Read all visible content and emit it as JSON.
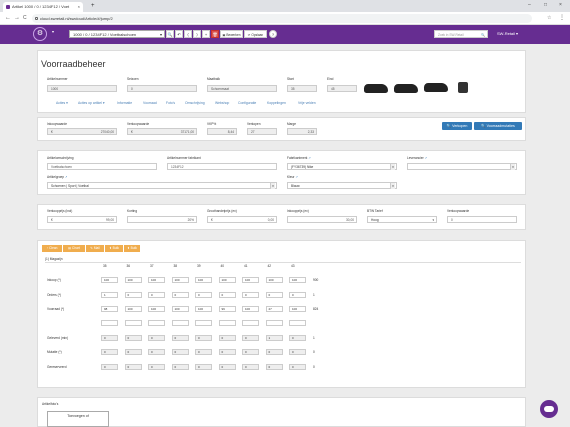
{
  "browser": {
    "tab_title": "Artikel 1000 / 0 / 1234F12 / Voet",
    "tab_close": "×",
    "new_tab": "+",
    "url": "cloud.swretail.nl/swcloud/Article/#/jump/2",
    "min": "–",
    "max": "□",
    "close": "×",
    "back": "←",
    "forward": "→",
    "reload": "C",
    "star": "☆",
    "menu": "⋮"
  },
  "app": {
    "logo_glyph": "⚙",
    "menu_caret": "▾",
    "article_select": "1000 / 0 / 1234F12 / Voetbalschoen",
    "dd": "▾",
    "tools": [
      "🔍",
      "↶",
      "⟨",
      "⟩",
      "+",
      "🗑"
    ],
    "btn_bewerken": "▣ Bewerken",
    "btn_opslaan": "⟳ Opslaan",
    "btn_info": "?",
    "search_placeholder": "Zoek in SW-Retail",
    "search_icon": "🔍",
    "account": "SW-Retail ▾",
    "accent": "#662d91"
  },
  "page": {
    "title": "Voorraadbeheer"
  },
  "head": {
    "l_artnr": "Artikelnummer",
    "v_artnr": "1000",
    "l_seizoen": "Seizoen",
    "v_seizoen": "0",
    "l_maatbalk": "Maatbalk",
    "v_maatbalk": "Schoenmaat",
    "l_start": "Start",
    "v_start": "35",
    "l_eind": "Eind",
    "v_eind": "45"
  },
  "nav": [
    "Acties ▾",
    "Acties op artikel ▾",
    "Informatie",
    "Voorraad",
    "Foto's",
    "Omschrijving",
    "Webshop",
    "Configuratie",
    "Koppelingen",
    "Vrije velden"
  ],
  "prices": {
    "l_inkwaarde": "Inkoopwaarde",
    "v_inkwaarde": "27040,00",
    "l_verkwaarde": "Verkoopwaarde",
    "v_verkwaarde": "37171,00",
    "l_vkpct": "VKP%",
    "v_vkpct": "8,44",
    "l_verkopen": "Verkopen",
    "v_verkopen": "27",
    "l_marge": "Marge",
    "v_marge": "2,33",
    "cur": "€",
    "btn_verkopen": "🔍 Verkopen",
    "btn_mutaties": "🔍 Voorraadmutaties"
  },
  "desc": {
    "l_oms": "Artikelomschrijving",
    "v_oms": "Voetbalschoen",
    "l_fabnr": "Artikelnummer fabrikant",
    "v_fabnr": "1234F12",
    "l_fabmerk": "Fabrikantmerk",
    "v_fabmerk": "(FY36739) Nike",
    "l_leverancier": "Leverancier",
    "v_leverancier": "",
    "l_groep": "Artikelgroep",
    "v_groep": "Schoenen | Sport | Voetbal",
    "l_kleur": "Kleur",
    "v_kleur": "Blauw",
    "link_icon": "↗",
    "dd": "▾"
  },
  "prices2": {
    "l_verkoop": "Verkoopprijs (incl)",
    "v_verkoop": "99,00",
    "l_korting": "Korting",
    "v_korting": "20%",
    "l_groot": "Groothandelprijs (ex)",
    "v_groot": "0,00",
    "l_inkoop": "Inkoopprijs (ex)",
    "v_inkoop": "30,00",
    "l_btw": "BTW Tarief",
    "v_btw": "Hoog",
    "l_vwaarde": "Verkoopwaarde",
    "v_vwaarde": "0",
    "cur": "€"
  },
  "stockbtns": [
    "↑ Clean",
    "▤ Chart",
    "✎ Mail",
    "⬆ Bulk",
    "⬆ Bulk"
  ],
  "stock": {
    "location": "(1) Magazijn",
    "sizes": [
      "35",
      "36",
      "37",
      "38",
      "39",
      "40",
      "41",
      "42",
      "43"
    ],
    "rows": [
      {
        "label": "Inkoop (*)",
        "values": [
          "100",
          "100",
          "100",
          "100",
          "100",
          "100",
          "100",
          "100",
          "100"
        ],
        "total": "900",
        "ro": false
      },
      {
        "label": "Orders (*)",
        "values": [
          "1",
          "0",
          "0",
          "0",
          "0",
          "0",
          "0",
          "0",
          "0"
        ],
        "total": "1",
        "ro": false
      },
      {
        "label": "Voorraad (*)",
        "values": [
          "98",
          "100",
          "100",
          "100",
          "100",
          "99",
          "100",
          "27",
          "100"
        ],
        "total": "824",
        "ro": false
      },
      {
        "label": "",
        "values": [
          "",
          "",
          "",
          "",
          "",
          "",
          "",
          "",
          ""
        ],
        "total": "",
        "ro": false
      },
      {
        "label": "Geleverd (min)",
        "values": [
          "0",
          "0",
          "0",
          "0",
          "0",
          "0",
          "0",
          "1",
          "0"
        ],
        "total": "1",
        "ro": true
      },
      {
        "label": "Mutatie (*)",
        "values": [
          "0",
          "0",
          "0",
          "0",
          "0",
          "0",
          "0",
          "0",
          "0"
        ],
        "total": "0",
        "ro": true
      },
      {
        "label": "Gereserveerd",
        "values": [
          "0",
          "0",
          "0",
          "0",
          "0",
          "0",
          "0",
          "0",
          "0"
        ],
        "total": "0",
        "ro": true
      }
    ]
  },
  "bottom": {
    "label": "Artikelfoto's",
    "box": "Toevoegen of"
  },
  "colors": {
    "purple": "#662d91",
    "blue": "#337ab7",
    "orange": "#f0ad4e",
    "red": "#d9534f"
  }
}
